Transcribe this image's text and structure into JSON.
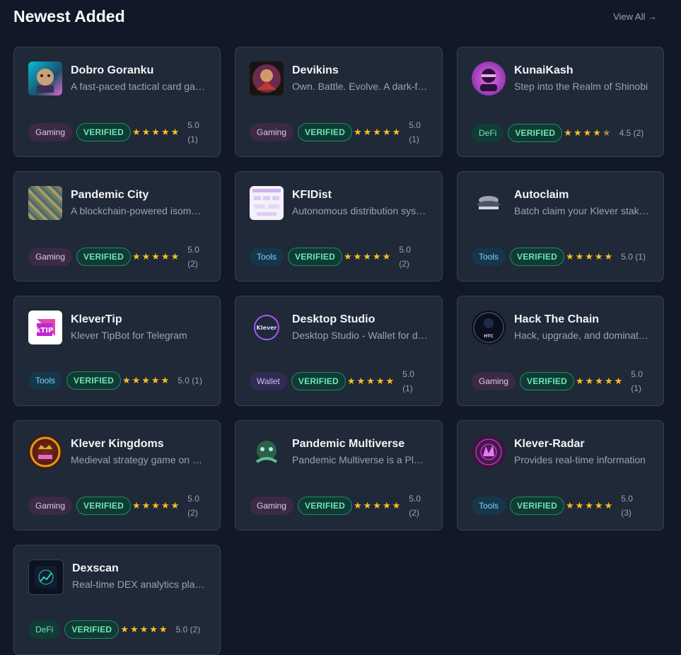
{
  "header": {
    "title": "Newest Added",
    "view_all": "View All →"
  },
  "verified_label": "VERIFIED",
  "apps": [
    {
      "name": "Dobro Goranku",
      "description": "A fast-paced tactical card game",
      "category": "Gaming",
      "stars": 5,
      "rating": "5.0",
      "reviews": "(1)"
    },
    {
      "name": "Devikins",
      "description": "Own. Battle. Evolve. A dark-fantasy RPG",
      "category": "Gaming",
      "stars": 5,
      "rating": "5.0",
      "reviews": "(1)"
    },
    {
      "name": "KunaiKash",
      "description": "Step into the Realm of Shinobi",
      "category": "DeFi",
      "stars": 4.5,
      "rating": "4.5",
      "reviews": "(2)"
    },
    {
      "name": "Pandemic City",
      "description": "A blockchain-powered isometric city",
      "category": "Gaming",
      "stars": 5,
      "rating": "5.0",
      "reviews": "(2)"
    },
    {
      "name": "KFIDist",
      "description": "Autonomous distribution system",
      "category": "Tools",
      "stars": 5,
      "rating": "5.0",
      "reviews": "(2)"
    },
    {
      "name": "Autoclaim",
      "description": "Batch claim your Klever staking rewards",
      "category": "Tools",
      "stars": 5,
      "rating": "5.0",
      "reviews": "(1)"
    },
    {
      "name": "KleverTip",
      "description": "Klever TipBot for Telegram",
      "category": "Tools",
      "stars": 5,
      "rating": "5.0",
      "reviews": "(1)"
    },
    {
      "name": "Desktop Studio",
      "description": "Desktop Studio - Wallet for desktop",
      "category": "Wallet",
      "stars": 5,
      "rating": "5.0",
      "reviews": "(1)"
    },
    {
      "name": "Hack The Chain",
      "description": "Hack, upgrade, and dominate the chain",
      "category": "Gaming",
      "stars": 5,
      "rating": "5.0",
      "reviews": "(1)"
    },
    {
      "name": "Klever Kingdoms",
      "description": "Medieval strategy game on Klever",
      "category": "Gaming",
      "stars": 5,
      "rating": "5.0",
      "reviews": "(2)"
    },
    {
      "name": "Pandemic Multiverse",
      "description": "Pandemic Multiverse is a Play-to-Earn",
      "category": "Gaming",
      "stars": 5,
      "rating": "5.0",
      "reviews": "(2)"
    },
    {
      "name": "Klever-Radar",
      "description": "Provides real-time information",
      "category": "Tools",
      "stars": 5,
      "rating": "5.0",
      "reviews": "(3)"
    },
    {
      "name": "Dexscan",
      "description": "Real-time DEX analytics platform",
      "category": "DeFi",
      "stars": 5,
      "rating": "5.0",
      "reviews": "(2)"
    }
  ],
  "logos": {
    "desktop_studio": "Klever",
    "klevertip": "kTIP",
    "hack_the_chain": "HTC"
  },
  "colors": {
    "background": "#111827",
    "card": "#1f2937",
    "star": "#fbbf24",
    "verified": "#6ee7b7"
  }
}
